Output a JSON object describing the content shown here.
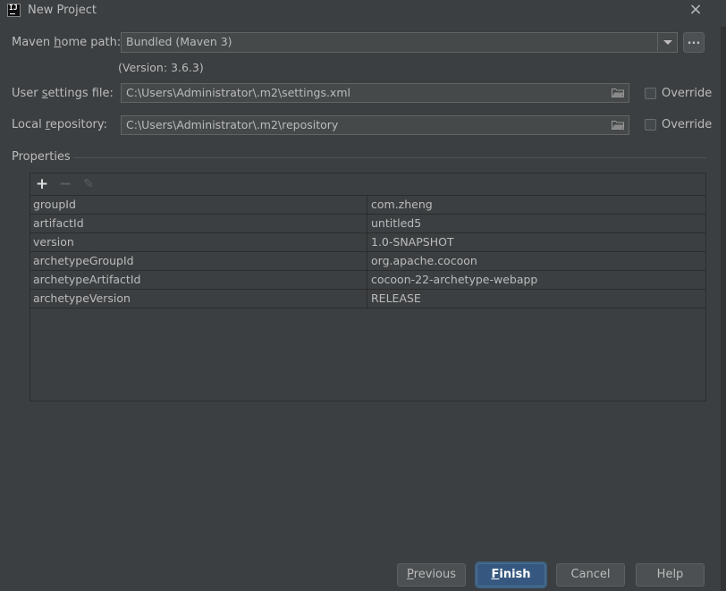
{
  "window": {
    "title": "New Project",
    "close_glyph": "×"
  },
  "maven": {
    "home_label_pre": "Maven ",
    "home_label_mnemonic": "h",
    "home_label_post": "ome path:",
    "home_value": "Bundled (Maven 3)",
    "version_text": "(Version: 3.6.3)",
    "dots_label": "...",
    "user_settings_label_pre": "User ",
    "user_settings_label_mnemonic": "s",
    "user_settings_label_post": "ettings file:",
    "user_settings_value": "C:\\Users\\Administrator\\.m2\\settings.xml",
    "local_repo_label_pre": "Local ",
    "local_repo_label_mnemonic": "r",
    "local_repo_label_post": "epository:",
    "local_repo_value": "C:\\Users\\Administrator\\.m2\\repository",
    "override_label": "Override"
  },
  "properties": {
    "section_title": "Properties",
    "toolbar": {
      "add_glyph": "+",
      "remove_glyph": "−",
      "edit_glyph": "✎"
    },
    "rows": [
      {
        "name": "groupId",
        "value": "com.zheng"
      },
      {
        "name": "artifactId",
        "value": "untitled5"
      },
      {
        "name": "version",
        "value": "1.0-SNAPSHOT"
      },
      {
        "name": "archetypeGroupId",
        "value": "org.apache.cocoon"
      },
      {
        "name": "archetypeArtifactId",
        "value": "cocoon-22-archetype-webapp"
      },
      {
        "name": "archetypeVersion",
        "value": "RELEASE"
      }
    ]
  },
  "footer": {
    "previous_mnemonic": "P",
    "previous_rest": "revious",
    "finish_mnemonic": "F",
    "finish_rest": "inish",
    "cancel_label": "Cancel",
    "help_label": "Help"
  },
  "colors": {
    "background": "#3c3f41",
    "field_background": "#45494a",
    "primary_button": "#365880"
  },
  "icons": [
    "intellij-app-icon",
    "close-icon",
    "dropdown-arrow-icon",
    "folder-icon",
    "add-icon",
    "remove-icon",
    "edit-icon"
  ]
}
